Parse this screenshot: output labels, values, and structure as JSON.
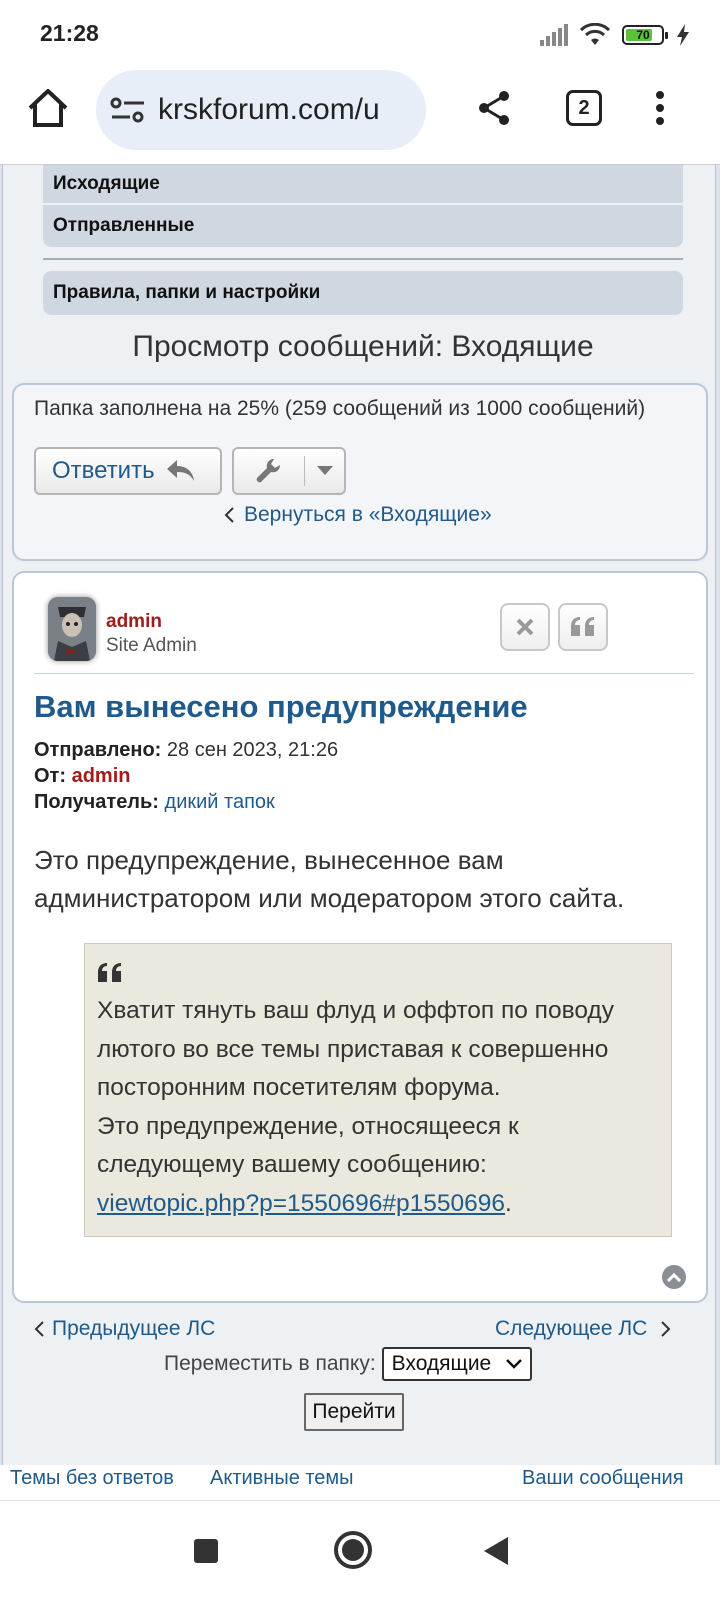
{
  "status_bar": {
    "time": "21:28",
    "battery_level": "70",
    "icons": [
      "signal-icon",
      "wifi-icon",
      "battery-icon",
      "charging-icon"
    ]
  },
  "browser": {
    "url": "krskforum.com/u",
    "tab_count": "2",
    "icons": [
      "home-icon",
      "site-settings-icon",
      "share-icon",
      "tabs-icon",
      "more-menu-icon"
    ]
  },
  "nav": {
    "items": [
      "Исходящие",
      "Отправленные"
    ],
    "settings": "Правила, папки и настройки"
  },
  "page_title": "Просмотр сообщений: Входящие",
  "folder": {
    "info": "Папка заполнена на 25% (259 сообщений из 1000 сообщений)",
    "reply_label": "Ответить",
    "back_link": "Вернуться в «Входящие»"
  },
  "post": {
    "author": "admin",
    "rank": "Site Admin",
    "title": "Вам вынесено предупреждение",
    "sent_label": "Отправлено:",
    "sent_value": "28 сен 2023, 21:26",
    "from_label": "От:",
    "from_value": "admin",
    "recipient_label": "Получатель:",
    "recipient_value": "дикий тапок",
    "body": "Это предупреждение, вынесенное вам администратором или модератором этого сайта.",
    "quote_line1": "Хватит тянуть ваш флуд и оффтоп по поводу лютого во все темы приставая к совершенно посторонним посетителям форума.",
    "quote_line2": "Это предупреждение, относящееся к следующему вашему сообщению:",
    "quote_link": "viewtopic.php?p=1550696#p1550696",
    "quote_link_suffix": "."
  },
  "pm_nav": {
    "prev": "Предыдущее ЛС",
    "next": "Следующее ЛС",
    "move_label": "Переместить в папку:",
    "move_selected": "Входящие",
    "go_label": "Перейти"
  },
  "footer": {
    "links": [
      "Темы без ответов",
      "Активные темы",
      "Ваши сообщения"
    ]
  }
}
